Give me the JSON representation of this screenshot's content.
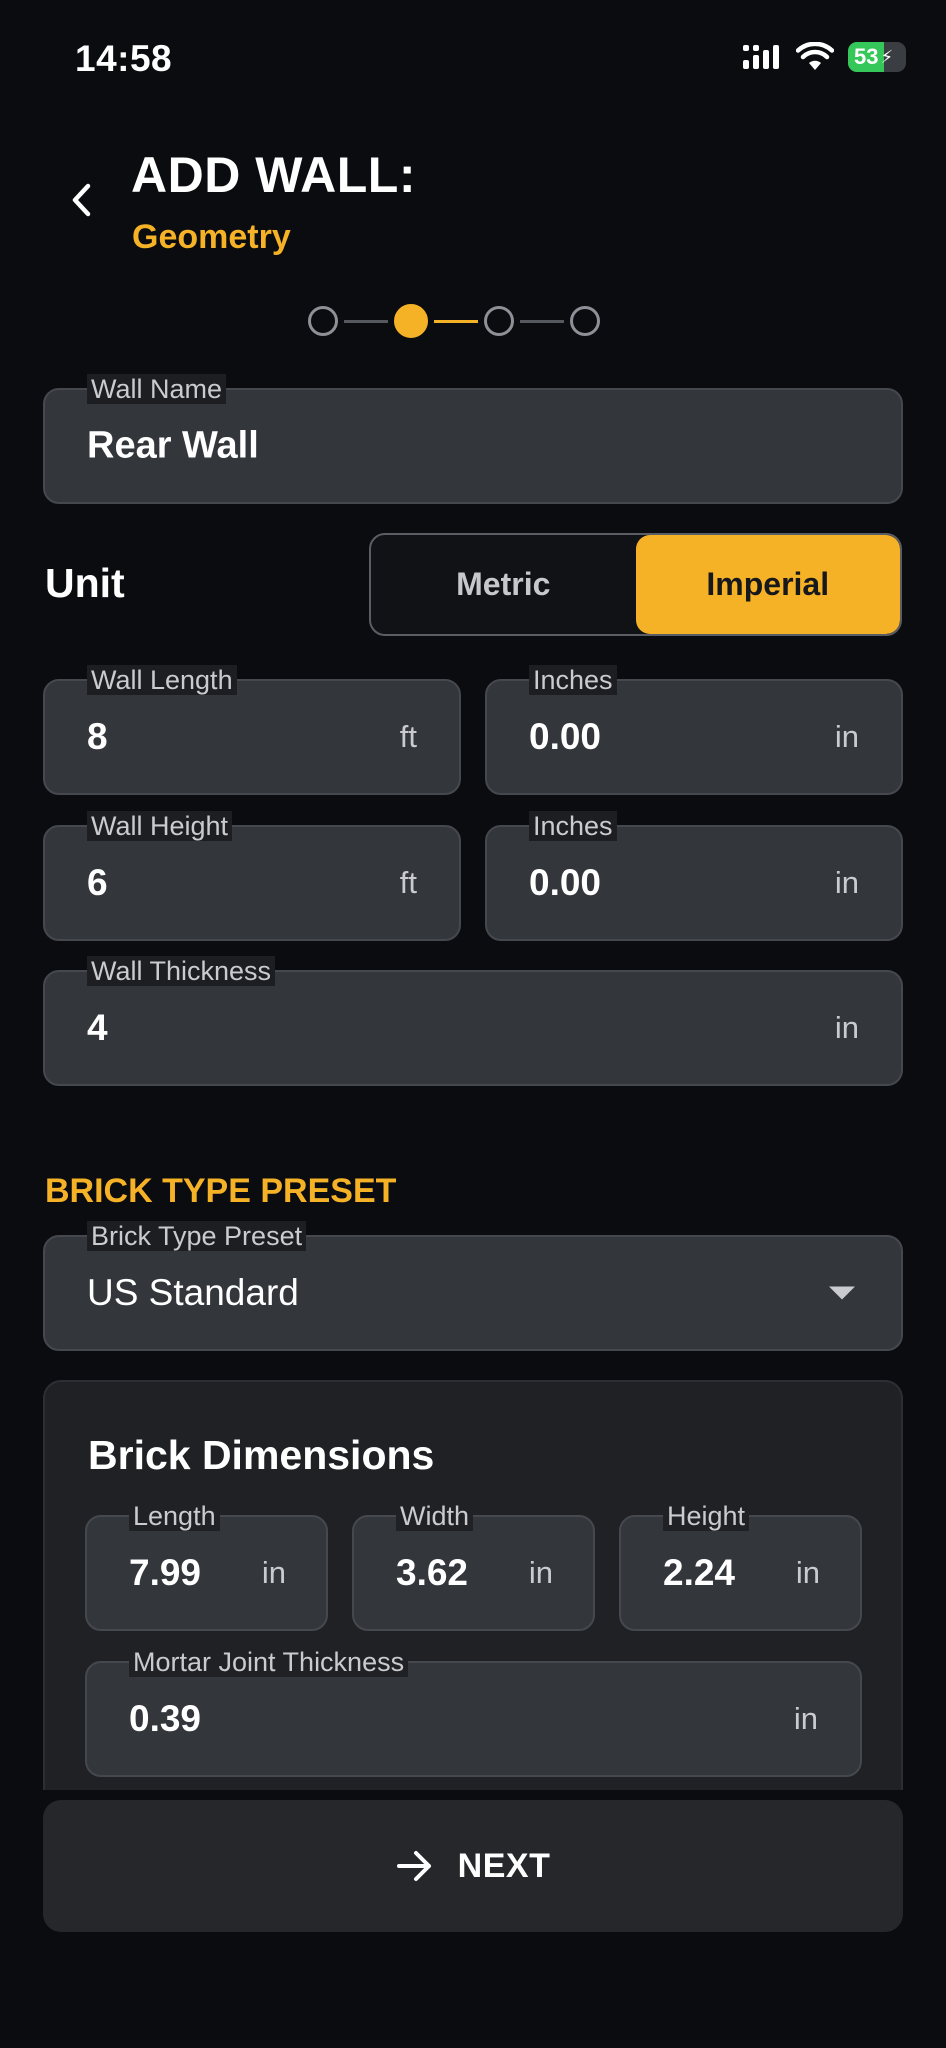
{
  "status_bar": {
    "time": "14:58",
    "battery": "53"
  },
  "header": {
    "title": "ADD WALL:",
    "subtitle": "Geometry"
  },
  "stepper": {
    "total_steps": 4,
    "current_step": 2
  },
  "form": {
    "wall_name": {
      "label": "Wall Name",
      "value": "Rear Wall"
    },
    "unit": {
      "label": "Unit",
      "options": [
        "Metric",
        "Imperial"
      ],
      "selected": "Imperial"
    },
    "wall_length": {
      "label": "Wall Length",
      "value": "8",
      "unit": "ft"
    },
    "wall_length_inches": {
      "label": "Inches",
      "value": "0.00",
      "unit": "in"
    },
    "wall_height": {
      "label": "Wall Height",
      "value": "6",
      "unit": "ft"
    },
    "wall_height_inches": {
      "label": "Inches",
      "value": "0.00",
      "unit": "in"
    },
    "wall_thickness": {
      "label": "Wall Thickness",
      "value": "4",
      "unit": "in"
    }
  },
  "brick": {
    "section_title": "BRICK TYPE PRESET",
    "preset": {
      "label": "Brick Type Preset",
      "value": "US Standard"
    },
    "dimensions_title": "Brick Dimensions",
    "length": {
      "label": "Length",
      "value": "7.99",
      "unit": "in"
    },
    "width": {
      "label": "Width",
      "value": "3.62",
      "unit": "in"
    },
    "height": {
      "label": "Height",
      "value": "2.24",
      "unit": "in"
    },
    "mortar": {
      "label": "Mortar Joint Thickness",
      "value": "0.39",
      "unit": "in"
    }
  },
  "actions": {
    "next_label": "NEXT"
  },
  "colors": {
    "accent": "#f6b227",
    "background": "#0b0c0f",
    "field": "#33363b"
  }
}
